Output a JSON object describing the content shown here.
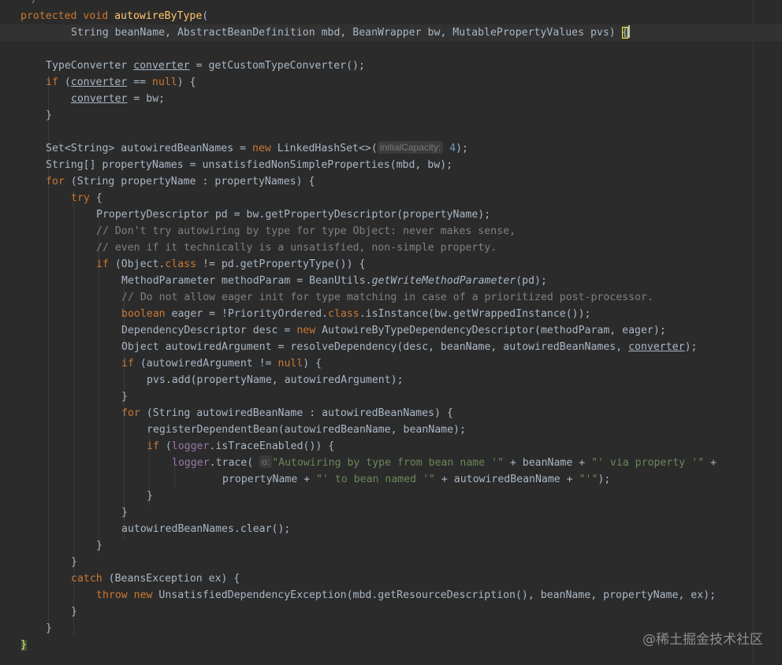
{
  "editor": {
    "line_top": {
      "text": "*/"
    },
    "method_signature": {
      "kw1": "protected",
      "kw2": "void",
      "name": "autowireByType",
      "paren": "("
    },
    "params": {
      "text": "String beanName, AbstractBeanDefinition mbd, BeanWrapper bw, MutablePropertyValues pvs) ",
      "open": "{"
    },
    "l_converter_a": "TypeConverter ",
    "l_converter_b": "converter",
    "l_converter_c": " = getCustomTypeConverter();",
    "l_if_kw": "if",
    "l_if_a": " (",
    "l_if_b": "converter",
    "l_if_c": " == ",
    "l_if_null": "null",
    "l_if_d": ") {",
    "l_assign_a": "converter",
    "l_assign_b": " = bw;",
    "l_close1": "}",
    "l_set_a": "Set<String> autowiredBeanNames = ",
    "l_set_new": "new",
    "l_set_b": " LinkedHashSet<>(",
    "l_set_hint": "initialCapacity:",
    "l_set_num": "4",
    "l_set_c": ");",
    "l_arr": "String[] propertyNames = unsatisfiedNonSimpleProperties(mbd, bw);",
    "l_for_kw": "for",
    "l_for_a": " (String propertyName : propertyNames) {",
    "l_try_kw": "try",
    "l_try_a": " {",
    "l_pd": "PropertyDescriptor pd = bw.getPropertyDescriptor(propertyName);",
    "c1": "// Don't try autowiring by type for type Object: never makes sense,",
    "c2": "// even if it technically is a unsatisfied, non-simple property.",
    "l_ifobj_kw": "if",
    "l_ifobj_a": " (Object.",
    "l_ifobj_class": "class",
    "l_ifobj_b": " != pd.getPropertyType()) {",
    "l_mp_a": "MethodParameter methodParam = BeanUtils.",
    "l_mp_it": "getWriteMethodParameter",
    "l_mp_b": "(pd);",
    "c3": "// Do not allow eager init for type matching in case of a prioritized post-processor.",
    "l_eager_kw": "boolean",
    "l_eager_a": " eager = !PriorityOrdered.",
    "l_eager_class": "class",
    "l_eager_b": ".isInstance(bw.getWrappedInstance());",
    "l_desc_a": "DependencyDescriptor desc = ",
    "l_desc_new": "new",
    "l_desc_b": " AutowireByTypeDependencyDescriptor(methodParam, eager);",
    "l_arg_a": "Object autowiredArgument = resolveDependency(desc, beanName, autowiredBeanNames, ",
    "l_arg_b": "converter",
    "l_arg_c": ");",
    "l_ifarg_kw": "if",
    "l_ifarg_a": " (autowiredArgument != ",
    "l_ifarg_null": "null",
    "l_ifarg_b": ") {",
    "l_pvs": "pvs.add(propertyName, autowiredArgument);",
    "l_close2": "}",
    "l_for2_kw": "for",
    "l_for2_a": " (String autowiredBeanName : autowiredBeanNames) {",
    "l_reg": "registerDependentBean(autowiredBeanName, beanName);",
    "l_iflog_kw": "if",
    "l_iflog_a": " (",
    "l_iflog_field": "logger",
    "l_iflog_b": ".isTraceEnabled()) {",
    "l_trace_field": "logger",
    "l_trace_a": ".trace(",
    "l_trace_hint": "o:",
    "l_trace_s1": "\"Autowiring by type from bean name '\"",
    "l_trace_b": " + beanName + ",
    "l_trace_s2": "\"' via property '\"",
    "l_trace_c": " +",
    "l_trace2_a": "propertyName + ",
    "l_trace2_s": "\"' to bean named '\"",
    "l_trace2_b": " + autowiredBeanName + ",
    "l_trace2_s2": "\"'\"",
    "l_trace2_c": ");",
    "l_close3": "}",
    "l_close4": "}",
    "l_clear": "autowiredBeanNames.clear();",
    "l_close5": "}",
    "l_close6": "}",
    "l_catch_kw": "catch",
    "l_catch_a": " (BeansException ex) {",
    "l_throw_kw": "throw",
    "l_throw_new": "new",
    "l_throw_a": " UnsatisfiedDependencyException(mbd.getResourceDescription(), beanName, propertyName, ex);",
    "l_close7": "}",
    "l_close8": "}",
    "l_close9": "}"
  },
  "watermark": "@稀土掘金技术社区",
  "colors": {
    "background": "#2b2b2b",
    "keyword": "#cc7832",
    "method": "#ffc66d",
    "comment": "#808080",
    "string": "#6a8759",
    "number": "#6897bb",
    "field": "#9876aa",
    "text": "#a9b7c6"
  }
}
